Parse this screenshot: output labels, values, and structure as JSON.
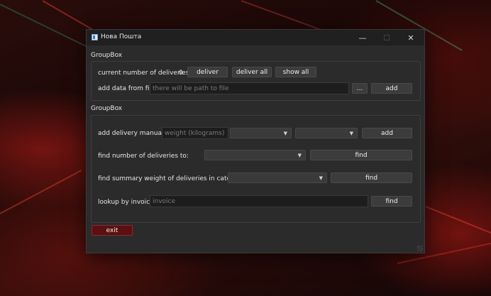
{
  "window": {
    "title": "Нова Пошта",
    "minimize_glyph": "—",
    "maximize_glyph": "☐",
    "close_glyph": "✕"
  },
  "group1": {
    "title": "GroupBox",
    "count_label": "current number of deliveries:",
    "count_value": "0",
    "deliver_label": "deliver",
    "deliver_all_label": "deliver all",
    "show_all_label": "show all",
    "file_label": "add data from file",
    "file_placeholder": "there will be path to file",
    "browse_label": "...",
    "add_label": "add"
  },
  "group2": {
    "title": "GroupBox",
    "manual_label": "add delivery manually:",
    "weight_placeholder": "weight (kilograms)",
    "manual_add_label": "add",
    "find_count_label": "find number of deliveries to:",
    "find_count_button": "find",
    "find_weight_label": "find summary weight of deliveries in category:",
    "find_weight_button": "find",
    "invoice_label": "lookup by invoice:",
    "invoice_placeholder": "invoice",
    "invoice_button": "find"
  },
  "exit_label": "exit",
  "colors": {
    "window_bg": "#2b2b2b",
    "titlebar_bg": "#202020",
    "button_bg": "#3c3c3c",
    "input_bg": "#1d1d1d",
    "exit_bg": "#5a1010",
    "wallpaper_accent": "#b01e18"
  }
}
